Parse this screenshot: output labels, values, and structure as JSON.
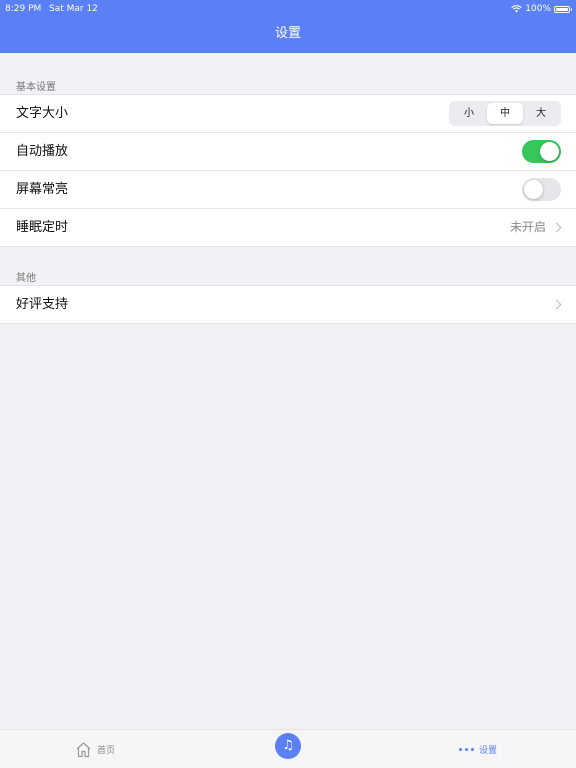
{
  "status_bar": {
    "time": "8:29 PM",
    "date": "Sat Mar 12",
    "battery": "100%"
  },
  "nav": {
    "title": "设置"
  },
  "sections": {
    "basic": {
      "header": "基本设置",
      "font_size": {
        "label": "文字大小",
        "options": [
          "小",
          "中",
          "大"
        ],
        "selected": "中"
      },
      "autoplay": {
        "label": "自动播放",
        "on": true
      },
      "screen_on": {
        "label": "屏幕常亮",
        "on": false
      },
      "sleep_timer": {
        "label": "睡眠定时",
        "value": "未开启"
      }
    },
    "other": {
      "header": "其他",
      "rate": {
        "label": "好评支持"
      }
    }
  },
  "tabbar": {
    "home_label": "首页",
    "settings_label": "设置",
    "play_glyph": "♫"
  },
  "colors": {
    "accent": "#5b7ff5",
    "toggle_on": "#34c759",
    "background": "#f1f1f6"
  }
}
